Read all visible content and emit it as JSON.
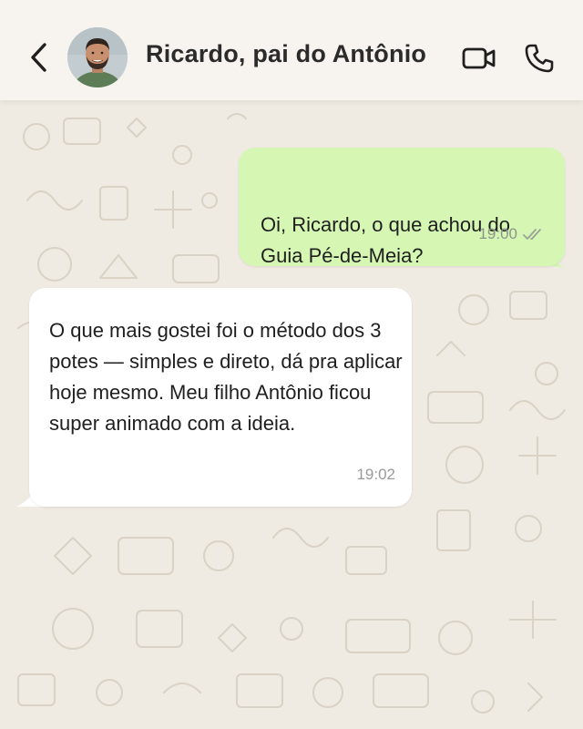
{
  "header": {
    "contact_name": "Ricardo, pai do Antônio",
    "back_icon": "chevron-left-icon",
    "video_icon": "video-camera-icon",
    "call_icon": "phone-icon"
  },
  "messages": [
    {
      "direction": "outgoing",
      "text": "Oi, Ricardo, o que achou do Guia Pé-de-Meia?",
      "time": "19:00",
      "status": "read"
    },
    {
      "direction": "incoming",
      "text": "O que mais gostei foi o método dos 3 potes — simples e direto, dá pra aplicar hoje mesmo. Meu filho Antônio ficou super animado com a ideia.",
      "time": "19:02"
    }
  ],
  "colors": {
    "outgoing_bubble": "#d6f7b4",
    "incoming_bubble": "#ffffff",
    "chat_background": "#efeae2",
    "header_background": "#f7f4ef"
  }
}
